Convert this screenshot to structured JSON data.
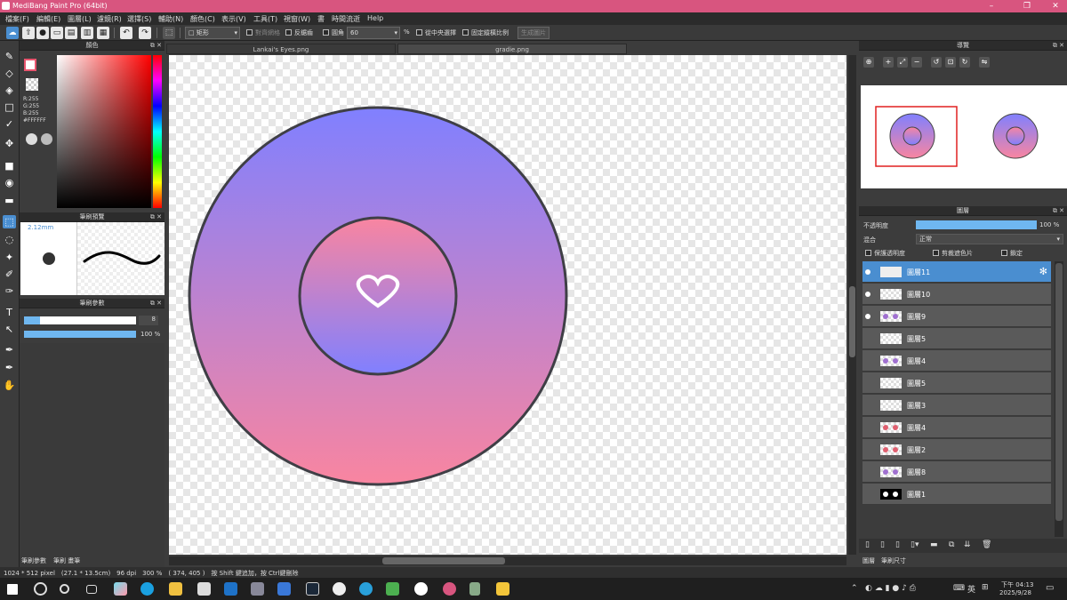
{
  "window": {
    "title": "MediBang Paint Pro (64bit)",
    "controls": [
      "–",
      "❐",
      "✕"
    ]
  },
  "menu": [
    "檔案(F)",
    "編輯(E)",
    "圖層(L)",
    "濾鏡(R)",
    "選擇(S)",
    "輔助(N)",
    "顏色(C)",
    "表示(V)",
    "工具(T)",
    "視窗(W)",
    "書",
    "時間流逝",
    "Help"
  ],
  "toolbar": {
    "shape_select": "矩形",
    "snap_label": "對齊網格",
    "antialias_label": "反鋸齒",
    "rounded_label": "圓角",
    "rounded_value": "60",
    "percent": "%",
    "from_center_label": "從中央選擇",
    "fix_ratio_label": "固定縱橫比例",
    "create_label": "生成圖片"
  },
  "color_panel": {
    "title": "顏色",
    "r": "R:255",
    "g": "G:255",
    "b": "B:255",
    "hex": "#FFFFFF",
    "fg_color": "#ffffff",
    "fg_border": "#e8556f"
  },
  "brush_preview": {
    "title": "筆刷預覽",
    "size_label": "2.12mm"
  },
  "brush_params": {
    "title": "筆刷參數",
    "size_value": "8",
    "opacity_value": "100 %"
  },
  "left_bottom_tabs": [
    "筆刷參數",
    "筆刷 畫筆"
  ],
  "canvas_tabs": [
    "Lankai's Eyes.png",
    "gradie.png"
  ],
  "navigator": {
    "title": "導覽"
  },
  "layers_panel": {
    "title": "圖層",
    "opacity_label": "不透明度",
    "opacity_value": "100 %",
    "opacity_fraction": 1.0,
    "blend_label": "混合",
    "blend_value": "正常",
    "protect_alpha_label": "保護透明度",
    "clip_label": "剪裁遮色片",
    "lock_label": "鎖定",
    "layers": [
      {
        "name": "圖層11",
        "selected": true,
        "visible": true,
        "thumb": "grad"
      },
      {
        "name": "圖層10",
        "selected": false,
        "visible": true,
        "thumb": "blank"
      },
      {
        "name": "圖層9",
        "selected": false,
        "visible": true,
        "thumb": "purple"
      },
      {
        "name": "圖層5",
        "selected": false,
        "visible": false,
        "thumb": "blank"
      },
      {
        "name": "圖層4",
        "selected": false,
        "visible": false,
        "thumb": "purple"
      },
      {
        "name": "圖層5",
        "selected": false,
        "visible": false,
        "thumb": "blank"
      },
      {
        "name": "圖層3",
        "selected": false,
        "visible": false,
        "thumb": "blank"
      },
      {
        "name": "圖層4",
        "selected": false,
        "visible": false,
        "thumb": "red"
      },
      {
        "name": "圖層2",
        "selected": false,
        "visible": false,
        "thumb": "red"
      },
      {
        "name": "圖層8",
        "selected": false,
        "visible": false,
        "thumb": "purple"
      },
      {
        "name": "圖層1",
        "selected": false,
        "visible": false,
        "thumb": "black"
      }
    ],
    "bottom_tabs": [
      "圖層",
      "筆刷尺寸"
    ]
  },
  "status": {
    "text": "1024 * 512 pixel　(27.1 * 13.5cm)　96 dpi　300 %　( 374, 405 )　按 Shift 鍵追加，按 Ctrl鍵刪除"
  },
  "taskbar": {
    "time": "下午 04:13",
    "date": "2025/9/28",
    "ime": "英"
  },
  "colors": {
    "title_bar": "#d8557f",
    "accent": "#4a8ed0",
    "ring_top": "#8080ff",
    "ring_bottom": "#f985a0",
    "outline": "#3f3f46"
  }
}
